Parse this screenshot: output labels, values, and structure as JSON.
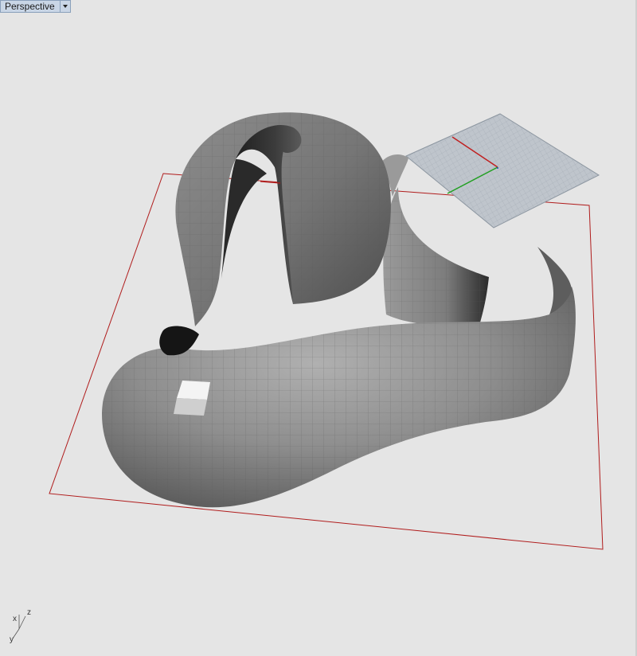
{
  "viewport": {
    "name": "Perspective",
    "menu_icon": "triangle-down-icon",
    "axes": {
      "x": "x",
      "y": "y",
      "z": "z"
    },
    "colors": {
      "background": "#e5e5e5",
      "construction_plane": "#b01c1c",
      "surface": "#8c8c8c",
      "grid": "#b9c0c8",
      "x_axis": "#c02020",
      "y_axis": "#20a020"
    }
  }
}
